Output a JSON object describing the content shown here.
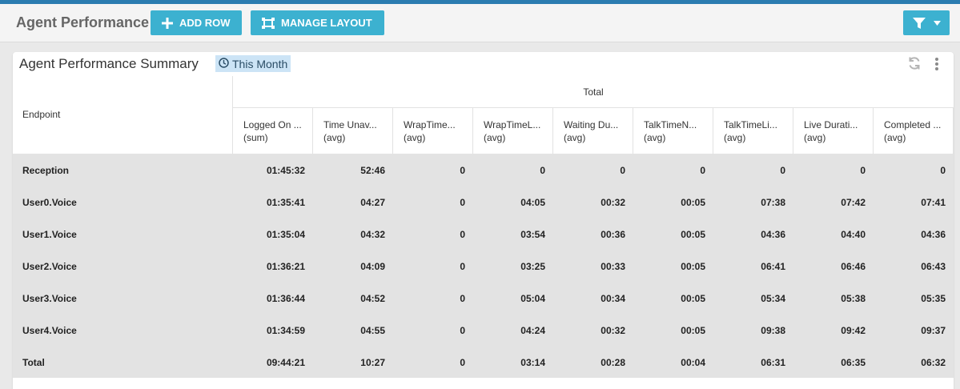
{
  "toolbar": {
    "title": "Agent Performance",
    "add_row_label": "ADD ROW",
    "manage_layout_label": "MANAGE LAYOUT",
    "icons": {
      "add": "plus-icon",
      "layout": "layout-icon",
      "filter": "filter-icon",
      "dropdown": "caret-down-icon"
    }
  },
  "colors": {
    "accent": "#3cb1d0",
    "top_strip": "#2b7cb0",
    "badge_bg": "#cce4f6",
    "row_bg": "#e3e3e3"
  },
  "panel": {
    "title": "Agent Performance Summary",
    "time_range": "This Month",
    "icons": {
      "time": "clock-icon",
      "refresh": "refresh-icon",
      "menu": "kebab-menu-icon"
    }
  },
  "table": {
    "endpoint_header": "Endpoint",
    "group_header": "Total",
    "columns": [
      {
        "label": "Logged On ...",
        "agg": "(sum)"
      },
      {
        "label": "Time Unav...",
        "agg": "(avg)"
      },
      {
        "label": "WrapTime...",
        "agg": "(avg)"
      },
      {
        "label": "WrapTimeL...",
        "agg": "(avg)"
      },
      {
        "label": "Waiting Du...",
        "agg": "(avg)"
      },
      {
        "label": "TalkTimeN...",
        "agg": "(avg)"
      },
      {
        "label": "TalkTimeLi...",
        "agg": "(avg)"
      },
      {
        "label": "Live Durati...",
        "agg": "(avg)"
      },
      {
        "label": "Completed ...",
        "agg": "(avg)"
      }
    ],
    "rows": [
      {
        "endpoint": "Reception",
        "values": [
          "01:45:32",
          "52:46",
          "0",
          "0",
          "0",
          "0",
          "0",
          "0",
          "0"
        ]
      },
      {
        "endpoint": "User0.Voice",
        "values": [
          "01:35:41",
          "04:27",
          "0",
          "04:05",
          "00:32",
          "00:05",
          "07:38",
          "07:42",
          "07:41"
        ]
      },
      {
        "endpoint": "User1.Voice",
        "values": [
          "01:35:04",
          "04:32",
          "0",
          "03:54",
          "00:36",
          "00:05",
          "04:36",
          "04:40",
          "04:36"
        ]
      },
      {
        "endpoint": "User2.Voice",
        "values": [
          "01:36:21",
          "04:09",
          "0",
          "03:25",
          "00:33",
          "00:05",
          "06:41",
          "06:46",
          "06:43"
        ]
      },
      {
        "endpoint": "User3.Voice",
        "values": [
          "01:36:44",
          "04:52",
          "0",
          "05:04",
          "00:34",
          "00:05",
          "05:34",
          "05:38",
          "05:35"
        ]
      },
      {
        "endpoint": "User4.Voice",
        "values": [
          "01:34:59",
          "04:55",
          "0",
          "04:24",
          "00:32",
          "00:05",
          "09:38",
          "09:42",
          "09:37"
        ]
      },
      {
        "endpoint": "Total",
        "values": [
          "09:44:21",
          "10:27",
          "0",
          "03:14",
          "00:28",
          "00:04",
          "06:31",
          "06:35",
          "06:32"
        ]
      }
    ]
  }
}
